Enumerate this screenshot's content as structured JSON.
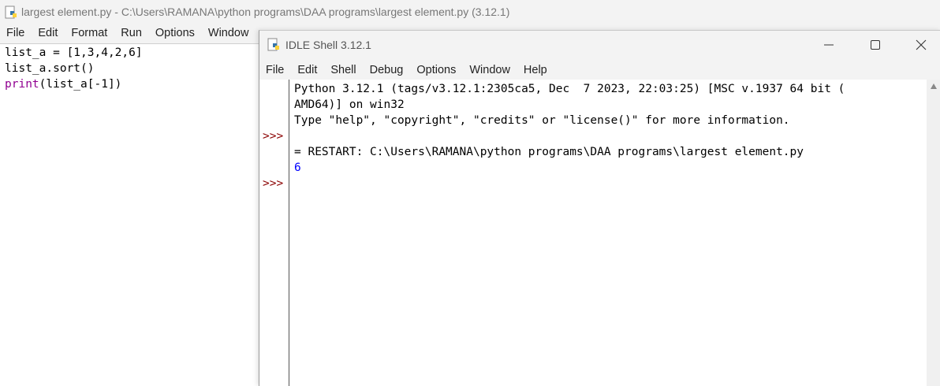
{
  "editor": {
    "title": "largest element.py - C:\\Users\\RAMANA\\python programs\\DAA programs\\largest element.py (3.12.1)",
    "menu": [
      "File",
      "Edit",
      "Format",
      "Run",
      "Options",
      "Window"
    ],
    "code": {
      "line1": "list_a = [1,3,4,2,6]",
      "line2": "list_a.sort()",
      "line3_builtin": "print",
      "line3_rest": "(list_a[-1])"
    }
  },
  "shell": {
    "title": "IDLE Shell 3.12.1",
    "menu": [
      "File",
      "Edit",
      "Shell",
      "Debug",
      "Options",
      "Window",
      "Help"
    ],
    "prompt": ">>>",
    "lines": {
      "banner1": "Python 3.12.1 (tags/v3.12.1:2305ca5, Dec  7 2023, 22:03:25) [MSC v.1937 64 bit (",
      "banner2": "AMD64)] on win32",
      "banner3": "Type \"help\", \"copyright\", \"credits\" or \"license()\" for more information.",
      "restart": "= RESTART: C:\\Users\\RAMANA\\python programs\\DAA programs\\largest element.py",
      "output": "6"
    }
  },
  "icons": {
    "app": "python-idle-icon",
    "minimize": "minimize-icon",
    "maximize": "maximize-icon",
    "close": "close-icon"
  }
}
